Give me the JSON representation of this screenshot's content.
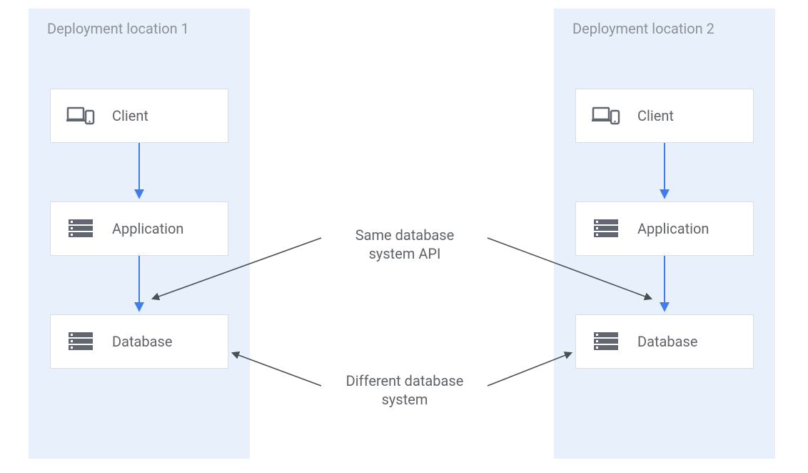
{
  "regions": {
    "r1": {
      "title": "Deployment location 1"
    },
    "r2": {
      "title": "Deployment location 2"
    }
  },
  "nodes": {
    "client": "Client",
    "application": "Application",
    "database": "Database"
  },
  "annotations": {
    "same_api": "Same database\nsystem API",
    "diff_system": "Different database\nsystem"
  },
  "colors": {
    "region_bg": "#e8f0fb",
    "box_border": "#d9dde2",
    "text": "#5f6368",
    "arrow_blue": "#3f7ee8",
    "arrow_dark": "#4a4f54"
  }
}
